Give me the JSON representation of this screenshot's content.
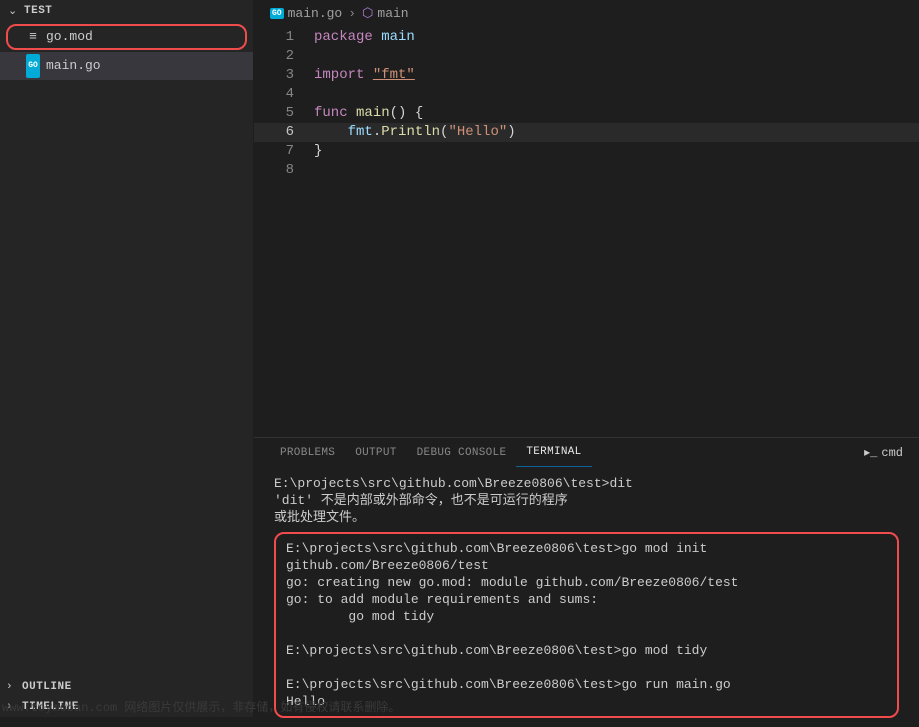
{
  "sidebar": {
    "title": "TEST",
    "files": [
      {
        "name": "go.mod",
        "icon": "gomod"
      },
      {
        "name": "main.go",
        "icon": "go"
      }
    ],
    "sections": [
      {
        "label": "OUTLINE"
      },
      {
        "label": "TIMELINE"
      }
    ]
  },
  "breadcrumb": {
    "file": "main.go",
    "symbol": "main"
  },
  "code": {
    "lines": [
      {
        "n": 1,
        "tokens": [
          [
            "kw",
            "package"
          ],
          [
            "",
            ""
          ],
          [
            "ident",
            " main"
          ]
        ]
      },
      {
        "n": 2,
        "tokens": []
      },
      {
        "n": 3,
        "tokens": [
          [
            "kw",
            "import"
          ],
          [
            "",
            " "
          ],
          [
            "str",
            "\"fmt\""
          ]
        ]
      },
      {
        "n": 4,
        "tokens": []
      },
      {
        "n": 5,
        "tokens": [
          [
            "kw",
            "func"
          ],
          [
            "",
            " "
          ],
          [
            "func",
            "main"
          ],
          [
            "punc",
            "() {"
          ]
        ]
      },
      {
        "n": 6,
        "tokens": [
          [
            "",
            "    "
          ],
          [
            "ident",
            "fmt"
          ],
          [
            "punc",
            "."
          ],
          [
            "func",
            "Println"
          ],
          [
            "punc",
            "("
          ],
          [
            "str",
            "\"Hello\""
          ],
          [
            "punc",
            ")"
          ]
        ]
      },
      {
        "n": 7,
        "tokens": [
          [
            "punc",
            "}"
          ]
        ]
      },
      {
        "n": 8,
        "tokens": []
      }
    ],
    "current_line": 6
  },
  "panel": {
    "tabs": [
      "PROBLEMS",
      "OUTPUT",
      "DEBUG CONSOLE",
      "TERMINAL"
    ],
    "active_tab": 3,
    "shell_label": "cmd"
  },
  "terminal": {
    "block1": [
      "E:\\projects\\src\\github.com\\Breeze0806\\test>dit",
      "'dit' 不是内部或外部命令，也不是可运行的程序",
      "或批处理文件。"
    ],
    "block2": [
      "E:\\projects\\src\\github.com\\Breeze0806\\test>go mod init github.com/Breeze0806/test",
      "go: creating new go.mod: module github.com/Breeze0806/test",
      "go: to add module requirements and sums:",
      "        go mod tidy",
      "",
      "E:\\projects\\src\\github.com\\Breeze0806\\test>go mod tidy",
      "",
      "E:\\projects\\src\\github.com\\Breeze0806\\test>go run main.go",
      "Hello"
    ]
  },
  "watermark": "www.toymoban.com 网络图片仅供展示，非存储，如有侵权请联系删除。"
}
